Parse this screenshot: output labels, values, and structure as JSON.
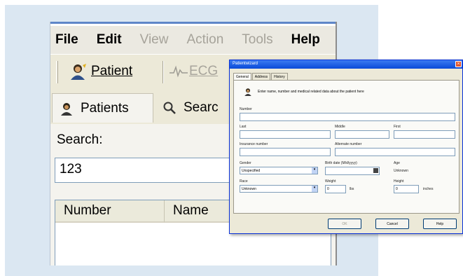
{
  "main_window": {
    "menu": [
      "File",
      "Edit",
      "View",
      "Action",
      "Tools",
      "Help"
    ],
    "toolbar": {
      "patient_label": "Patient",
      "ecg_label": "ECG"
    },
    "tabs": {
      "patients": "Patients",
      "search": "Searc"
    },
    "search": {
      "label": "Search:",
      "value": "123"
    },
    "table": {
      "columns": [
        "Number",
        "Name"
      ]
    }
  },
  "dialog": {
    "title": "Patientwizard",
    "tabs": [
      "General",
      "Address",
      "History"
    ],
    "intro": "Enter name, number and medical related data about the patient here",
    "fields": {
      "number": "Number",
      "last": "Last",
      "middle": "Middle",
      "first": "First",
      "insurance_number": "Insurance number",
      "alternate_number": "Alternate number",
      "gender": "Gender",
      "gender_value": "Unspecified",
      "birth_date": "Birth date (M/d/yyyy)",
      "age": "Age",
      "age_value": "Unknown",
      "race": "Race",
      "race_value": "Unknown",
      "weight": "Weight",
      "weight_value": "0",
      "weight_unit": "lbs",
      "height": "Height",
      "height_value": "0",
      "height_unit": "inches"
    },
    "buttons": {
      "ok": "OK",
      "cancel": "Cancel",
      "help": "Help"
    }
  }
}
